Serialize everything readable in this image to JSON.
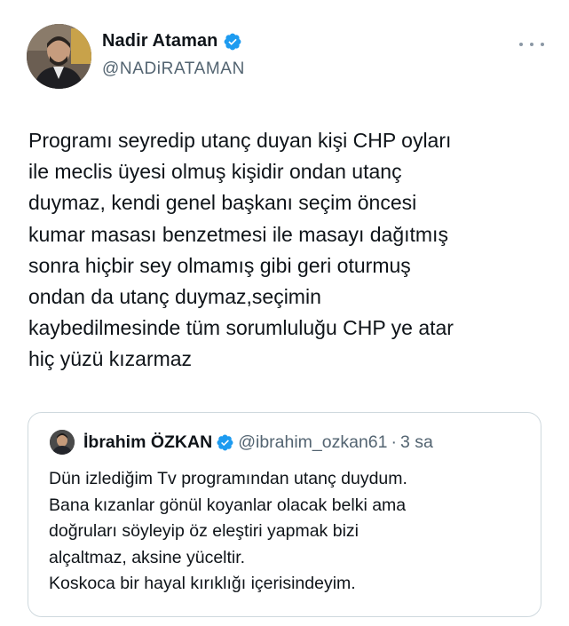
{
  "author": {
    "name": "Nadir Ataman",
    "handle": "@NADiRATAMAN"
  },
  "tweet": {
    "text": "Programı seyredip utanç duyan kişi CHP oyları\nile meclis üyesi olmuş kişidir ondan utanç\nduymaz, kendi genel başkanı seçim öncesi\nkumar masası benzetmesi ile masayı dağıtmış\nsonra hiçbir sey olmamış gibi geri oturmuş\nondan da utanç duymaz,seçimin\nkaybedilmesinde tüm sorumluluğu CHP ye atar\nhiç yüzü kızarmaz"
  },
  "quoted": {
    "name": "İbrahim ÖZKAN",
    "handle": "@ibrahim_ozkan61",
    "separator": "·",
    "time": "3 sa",
    "text": "Dün izlediğim Tv programından utanç duydum.\nBana kızanlar gönül koyanlar olacak belki ama\ndoğruları söyleyip öz eleştiri yapmak bizi\nalçaltmaz, aksine yüceltir.\nKoskoca bir hayal kırıklığı içerisindeyim."
  },
  "colors": {
    "verified": "#1d9bf0",
    "secondary_text": "#536471",
    "border": "#cfd9de"
  },
  "icons": {
    "verified": "verified-badge-icon",
    "more": "more-options-icon"
  }
}
